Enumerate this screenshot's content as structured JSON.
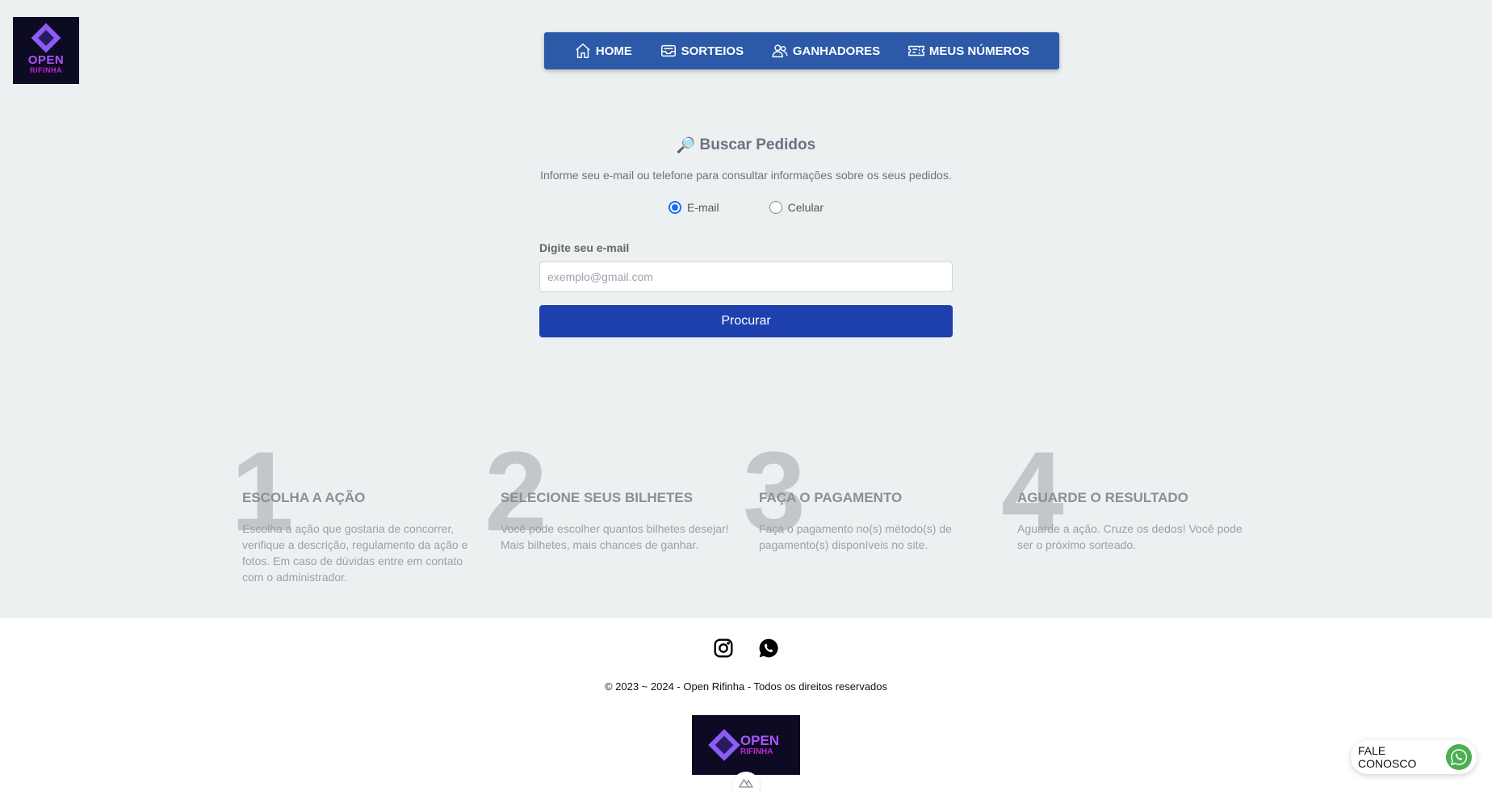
{
  "brand": {
    "logo_line1": "OPEN",
    "logo_line2": "RIFINHA"
  },
  "nav": {
    "items": [
      {
        "label": "HOME",
        "icon": "home-icon"
      },
      {
        "label": "SORTEIOS",
        "icon": "inbox-icon"
      },
      {
        "label": "GANHADORES",
        "icon": "users-icon"
      },
      {
        "label": "MEUS NÚMEROS",
        "icon": "ticket-icon"
      }
    ]
  },
  "search": {
    "title_icon": "🔎",
    "title": "Buscar Pedidos",
    "description": "Informe seu e-mail ou telefone para consultar informações sobre os seus pedidos.",
    "options": [
      {
        "label": "E-mail",
        "checked": true
      },
      {
        "label": "Celular",
        "checked": false
      }
    ],
    "field_label": "Digite seu e-mail",
    "placeholder": "exemplo@gmail.com",
    "value": "",
    "button_label": "Procurar"
  },
  "steps": [
    {
      "number": "1",
      "title": "ESCOLHA A AÇÃO",
      "description": "Escolha a ação que gostaria de concorrer, verifique a descrição, regulamento da ação e fotos. Em caso de dúvidas entre em contato com o administrador."
    },
    {
      "number": "2",
      "title": "SELECIONE SEUS BILHETES",
      "description": "Você pode escolher quantos bilhetes desejar! Mais bilhetes, mais chances de ganhar."
    },
    {
      "number": "3",
      "title": "FAÇA O PAGAMENTO",
      "description": "Faça o pagamento no(s) método(s) de pagamento(s) disponíveis no site."
    },
    {
      "number": "4",
      "title": "AGUARDE O RESULTADO",
      "description": "Aguarde a ação. Cruze os dedos! Você pode ser o próximo sorteado."
    }
  ],
  "footer": {
    "social": [
      {
        "icon": "instagram-icon"
      },
      {
        "icon": "whatsapp-icon"
      }
    ],
    "copyright": "© 2023 ~ 2024 - Open Rifinha - Todos os direitos reservados",
    "logo_line1": "OPEN",
    "logo_line2": "RIFINHA"
  },
  "contact": {
    "label": "FALE CONOSCO",
    "icon": "whatsapp-icon"
  },
  "colors": {
    "nav_bg": "#2c5aa8",
    "button_bg": "#1e40af",
    "page_bg": "#ecf0f1",
    "logo_bg": "#0d0a24",
    "logo_purple": "#a855f7",
    "whatsapp_green": "#4caf50"
  }
}
